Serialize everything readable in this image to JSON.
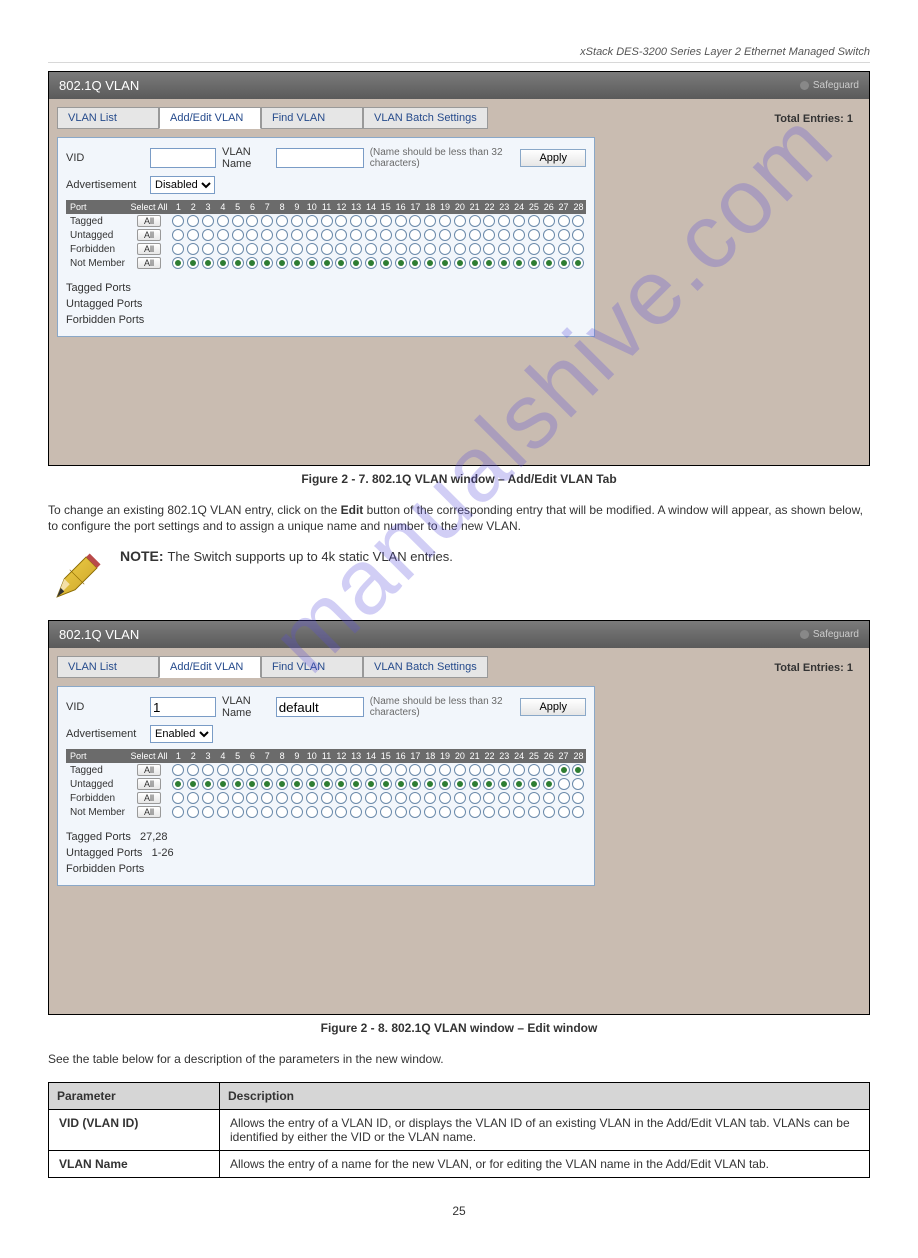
{
  "header_italic": "xStack DES-3200 Series Layer 2 Ethernet Managed Switch",
  "watermark": "manualshive.com",
  "titlebar": {
    "title": "802.1Q VLAN",
    "safeguard": "Safeguard"
  },
  "tabs": {
    "t1": "VLAN List",
    "t2": "Add/Edit VLAN",
    "t3": "Find VLAN",
    "t4": "VLAN Batch Settings",
    "entries": "Total Entries: 1"
  },
  "form": {
    "vid_lbl": "VID",
    "vlan_name_lbl": "VLAN Name",
    "hint": "(Name should be less than 32 characters)",
    "apply": "Apply",
    "adv_lbl": "Advertisement",
    "adv_disabled": "Disabled",
    "adv_enabled": "Enabled",
    "vid_val_new": "",
    "vlan_name_val_new": "",
    "vid_val_edit": "1",
    "vlan_name_val_edit": "default"
  },
  "grid": {
    "port_hdr": "Port",
    "select_all_hdr": "Select All",
    "rows": [
      "Tagged",
      "Untagged",
      "Forbidden",
      "Not Member"
    ],
    "all_btn": "All",
    "port_count": 28
  },
  "summary_lbls": {
    "tp": "Tagged Ports",
    "up": "Untagged Ports",
    "fp": "Forbidden Ports"
  },
  "summary_vals_edit": {
    "tp": "27,28",
    "up": "1-26",
    "fp": ""
  },
  "captions": {
    "fig1": "Figure 2 - 7. 802.1Q VLAN window – Add/Edit VLAN Tab",
    "fig2": "Figure 2 - 8. 802.1Q VLAN window – Edit window"
  },
  "paras": {
    "p1_a": "To change an existing 802.1Q VLAN entry, click on the ",
    "p1_b": "Edit",
    "p1_c": " button of the corresponding entry that will be modified. A window will appear, as shown below, to configure the port settings and to assign a unique name and number to the new VLAN.",
    "p2_a": "See the table below for a description of the parameters in the new window.",
    "note_title": "NOTE: ",
    "note_body": "The Switch supports up to 4k static VLAN entries."
  },
  "param_table": {
    "hdr_p": "Parameter",
    "hdr_d": "Description",
    "r1_p": "VID (VLAN ID)",
    "r1_d": "Allows the entry of a VLAN ID, or displays the VLAN ID of an existing VLAN in the Add/Edit VLAN tab. VLANs can be identified by either the VID or the VLAN name.",
    "r2_p": "VLAN Name",
    "r2_d": "Allows the entry of a name for the new VLAN, or for editing the VLAN name in the Add/Edit VLAN tab."
  },
  "page_number": "25"
}
